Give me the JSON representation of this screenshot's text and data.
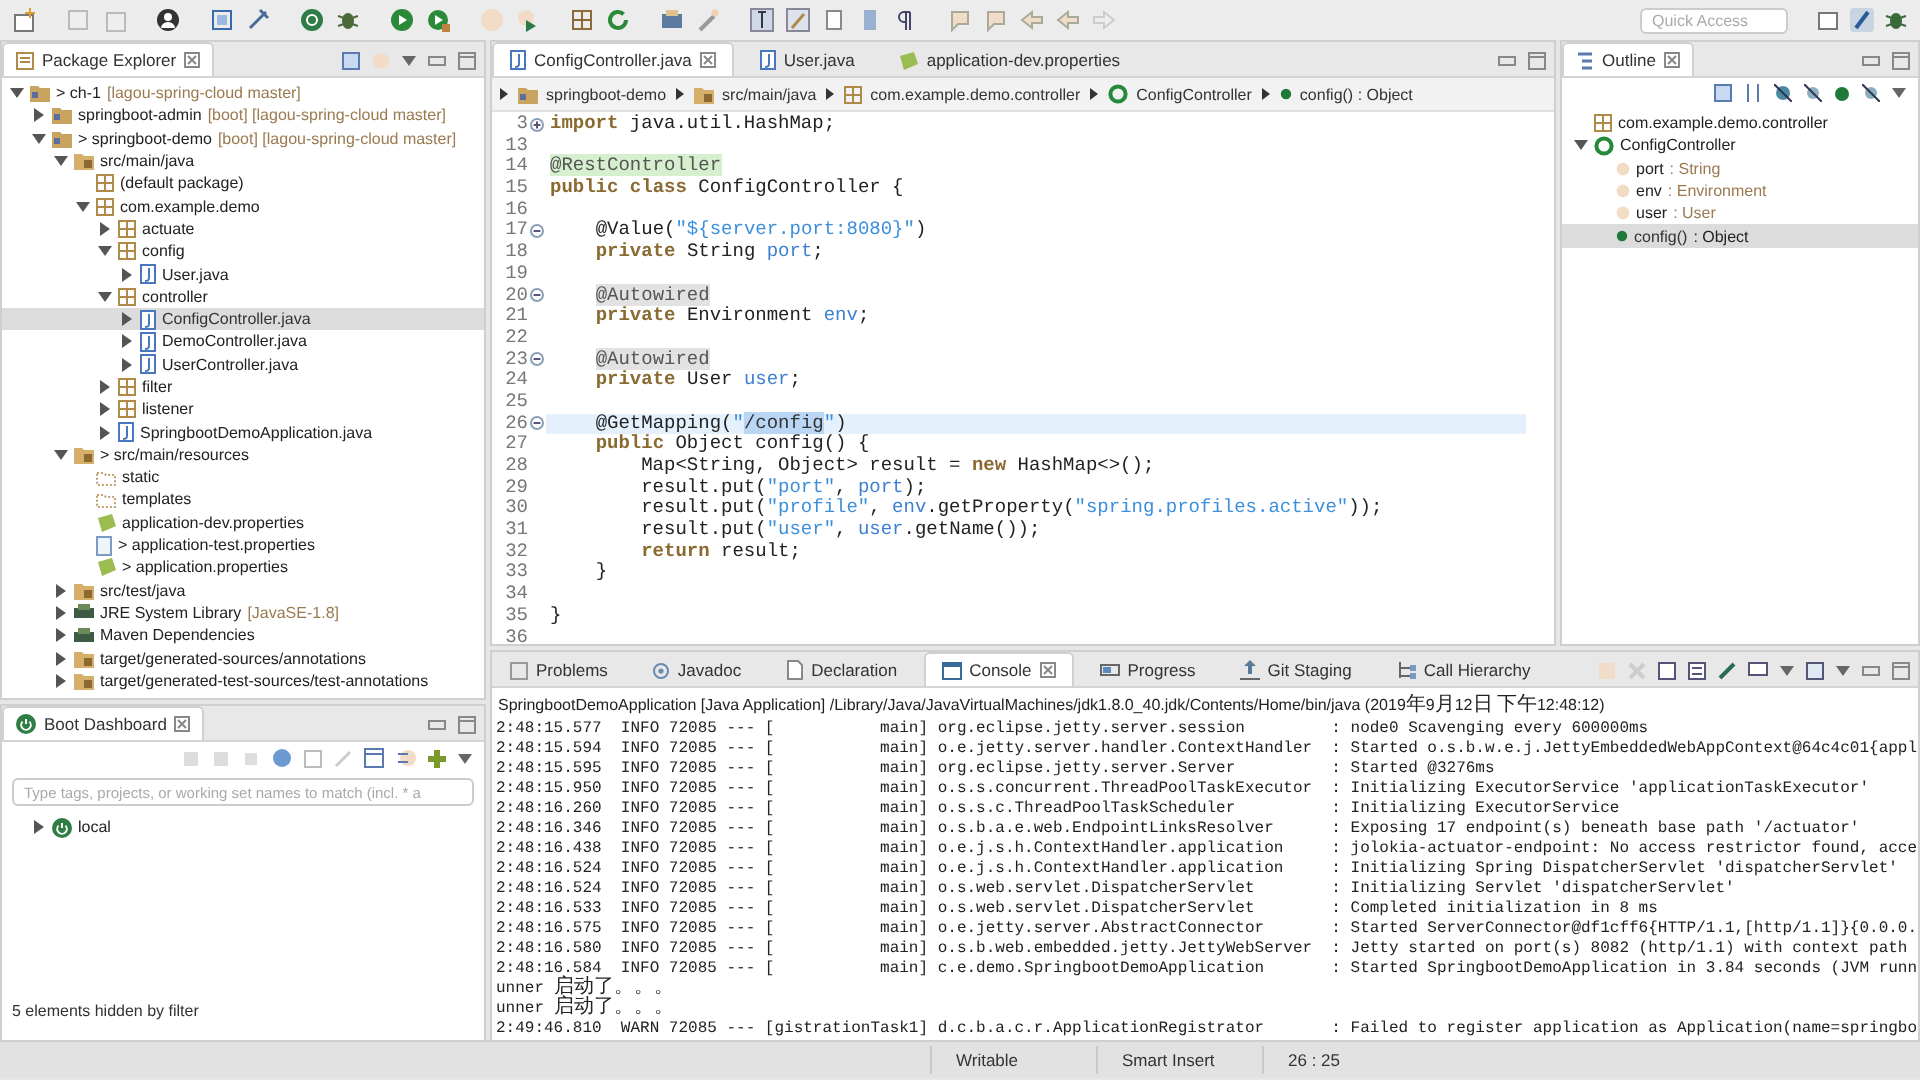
{
  "toolbar": {
    "quick_access": {
      "placeholder": "Quick Access"
    }
  },
  "package_explorer": {
    "title": "Package Explorer",
    "tree": [
      {
        "label": "> ch-1",
        "decoration": "[lagou-spring-cloud master]",
        "kind": "project",
        "expanded": true,
        "selected": false,
        "children": [
          {
            "label": "springboot-admin",
            "decoration": "[boot] [lagou-spring-cloud master]",
            "kind": "project",
            "expanded": false,
            "selected": false
          },
          {
            "label": "> springboot-demo",
            "decoration": "[boot] [lagou-spring-cloud master]",
            "kind": "project",
            "expanded": true,
            "selected": false,
            "children": [
              {
                "label": "src/main/java",
                "kind": "srcfolder",
                "expanded": true,
                "selected": false,
                "children": [
                  {
                    "label": "(default package)",
                    "kind": "package",
                    "selected": false
                  },
                  {
                    "label": "com.example.demo",
                    "kind": "package",
                    "expanded": true,
                    "selected": false,
                    "children": [
                      {
                        "label": "actuate",
                        "kind": "package",
                        "expanded": false,
                        "selected": false
                      },
                      {
                        "label": "config",
                        "kind": "package",
                        "expanded": true,
                        "selected": false,
                        "children": [
                          {
                            "label": "User.java",
                            "kind": "java",
                            "expanded": false,
                            "selected": false
                          }
                        ]
                      },
                      {
                        "label": "controller",
                        "kind": "package",
                        "expanded": true,
                        "selected": false,
                        "children": [
                          {
                            "label": "ConfigController.java",
                            "kind": "java",
                            "expanded": false,
                            "selected": true
                          },
                          {
                            "label": "DemoController.java",
                            "kind": "java",
                            "expanded": false,
                            "selected": false
                          },
                          {
                            "label": "UserController.java",
                            "kind": "java",
                            "expanded": false,
                            "selected": false
                          }
                        ]
                      },
                      {
                        "label": "filter",
                        "kind": "package",
                        "expanded": false,
                        "selected": false
                      },
                      {
                        "label": "listener",
                        "kind": "package",
                        "expanded": false,
                        "selected": false
                      },
                      {
                        "label": "SpringbootDemoApplication.java",
                        "kind": "java",
                        "expanded": false,
                        "selected": false
                      }
                    ]
                  }
                ]
              },
              {
                "label": "> src/main/resources",
                "kind": "srcfolder",
                "expanded": true,
                "selected": false,
                "children": [
                  {
                    "label": "static",
                    "kind": "folder",
                    "selected": false
                  },
                  {
                    "label": "templates",
                    "kind": "folder",
                    "selected": false
                  },
                  {
                    "label": "application-dev.properties",
                    "kind": "props",
                    "selected": false
                  },
                  {
                    "label": "> application-test.properties",
                    "kind": "file",
                    "selected": false
                  },
                  {
                    "label": "> application.properties",
                    "kind": "props",
                    "selected": false
                  }
                ]
              },
              {
                "label": "src/test/java",
                "kind": "srcfolder",
                "expanded": false,
                "selected": false
              },
              {
                "label": "JRE System Library",
                "decoration": "[JavaSE-1.8]",
                "kind": "library",
                "expanded": false,
                "selected": false
              },
              {
                "label": "Maven Dependencies",
                "kind": "library",
                "expanded": false,
                "selected": false
              },
              {
                "label": "target/generated-sources/annotations",
                "kind": "srcfolder",
                "expanded": false,
                "selected": false
              },
              {
                "label": "target/generated-test-sources/test-annotations",
                "kind": "srcfolder",
                "expanded": false,
                "selected": false
              }
            ]
          }
        ]
      }
    ]
  },
  "boot_dashboard": {
    "title": "Boot Dashboard",
    "filter": {
      "placeholder": "Type tags, projects, or working set names to match (incl. * a"
    },
    "tree": [
      {
        "label": "local",
        "kind": "boot",
        "expanded": false,
        "selected": false
      }
    ],
    "footer": "5 elements hidden by filter"
  },
  "editor": {
    "tabs": [
      {
        "label": "ConfigController.java",
        "kind": "java",
        "selected": true
      },
      {
        "label": "User.java",
        "kind": "java",
        "selected": false
      },
      {
        "label": "application-dev.properties",
        "kind": "props",
        "selected": false
      }
    ],
    "breadcrumb": [
      {
        "label": "springboot-demo",
        "kind": "project"
      },
      {
        "label": "src/main/java",
        "kind": "srcfolder"
      },
      {
        "label": "com.example.demo.controller",
        "kind": "package"
      },
      {
        "label": "ConfigController",
        "kind": "class"
      },
      {
        "label": "config() : Object",
        "kind": "method"
      }
    ],
    "lines": [
      {
        "number": "3",
        "expanded": false,
        "segments": [
          {
            "kind": "kw",
            "text": "import"
          },
          {
            "kind": "plain",
            "text": " java.util.HashMap;"
          }
        ]
      },
      {
        "number": "13"
      },
      {
        "number": "14",
        "segments": [
          {
            "kind": "ann-marked",
            "text": "@RestController"
          }
        ]
      },
      {
        "number": "15",
        "segments": [
          {
            "kind": "kw",
            "text": "public"
          },
          {
            "kind": "kw",
            "text": " class"
          },
          {
            "kind": "plain",
            "text": " ConfigController {"
          }
        ]
      },
      {
        "number": "16"
      },
      {
        "number": "17",
        "expanded": true,
        "segments": [
          {
            "kind": "plain",
            "text": "    @Value("
          },
          {
            "kind": "str",
            "text": "\"${server.port:8080}\""
          },
          {
            "kind": "plain",
            "text": ")"
          }
        ]
      },
      {
        "number": "18",
        "segments": [
          {
            "kind": "kw",
            "text": "    private"
          },
          {
            "kind": "plain",
            "text": " String "
          },
          {
            "kind": "field",
            "text": "port"
          },
          {
            "kind": "plain",
            "text": ";"
          }
        ]
      },
      {
        "number": "19"
      },
      {
        "number": "20",
        "expanded": true,
        "segments": [
          {
            "kind": "ann-match",
            "text": "    @Autowired"
          }
        ]
      },
      {
        "number": "21",
        "segments": [
          {
            "kind": "kw",
            "text": "    private"
          },
          {
            "kind": "plain",
            "text": " Environment "
          },
          {
            "kind": "field",
            "text": "env"
          },
          {
            "kind": "plain",
            "text": ";"
          }
        ]
      },
      {
        "number": "22"
      },
      {
        "number": "23",
        "expanded": true,
        "segments": [
          {
            "kind": "ann-match",
            "text": "    @Autowired"
          }
        ]
      },
      {
        "number": "24",
        "segments": [
          {
            "kind": "kw",
            "text": "    private"
          },
          {
            "kind": "plain",
            "text": " User "
          },
          {
            "kind": "field",
            "text": "user"
          },
          {
            "kind": "plain",
            "text": ";"
          }
        ]
      },
      {
        "number": "25"
      },
      {
        "number": "26",
        "expanded": true,
        "current": true,
        "segments": [
          {
            "kind": "plain",
            "text": "    @GetMapping("
          },
          {
            "kind": "str",
            "text": "\""
          },
          {
            "kind": "sel",
            "text": "/config"
          },
          {
            "kind": "str",
            "text": "\""
          },
          {
            "kind": "plain",
            "text": ")"
          }
        ]
      },
      {
        "number": "27",
        "segments": [
          {
            "kind": "kw",
            "text": "    public"
          },
          {
            "kind": "plain",
            "text": " Object config() {"
          }
        ]
      },
      {
        "number": "28",
        "segments": [
          {
            "kind": "plain",
            "text": "        Map<String, Object> result = "
          },
          {
            "kind": "kw",
            "text": "new"
          },
          {
            "kind": "plain",
            "text": " HashMap<>();"
          }
        ]
      },
      {
        "number": "29",
        "segments": [
          {
            "kind": "plain",
            "text": "        result.put("
          },
          {
            "kind": "str",
            "text": "\"port\""
          },
          {
            "kind": "plain",
            "text": ", "
          },
          {
            "kind": "field",
            "text": "port"
          },
          {
            "kind": "plain",
            "text": ");"
          }
        ]
      },
      {
        "number": "30",
        "segments": [
          {
            "kind": "plain",
            "text": "        result.put("
          },
          {
            "kind": "str",
            "text": "\"profile\""
          },
          {
            "kind": "plain",
            "text": ", "
          },
          {
            "kind": "field",
            "text": "env"
          },
          {
            "kind": "plain",
            "text": ".getProperty("
          },
          {
            "kind": "str",
            "text": "\"spring.profiles.active\""
          },
          {
            "kind": "plain",
            "text": "));"
          }
        ]
      },
      {
        "number": "31",
        "segments": [
          {
            "kind": "plain",
            "text": "        result.put("
          },
          {
            "kind": "str",
            "text": "\"user\""
          },
          {
            "kind": "plain",
            "text": ", "
          },
          {
            "kind": "field",
            "text": "user"
          },
          {
            "kind": "plain",
            "text": ".getName());"
          }
        ]
      },
      {
        "number": "32",
        "segments": [
          {
            "kind": "kw",
            "text": "        return"
          },
          {
            "kind": "plain",
            "text": " result;"
          }
        ]
      },
      {
        "number": "33",
        "segments": [
          {
            "kind": "plain",
            "text": "    }"
          }
        ]
      },
      {
        "number": "34"
      },
      {
        "number": "35",
        "segments": [
          {
            "kind": "plain",
            "text": "}"
          }
        ]
      },
      {
        "number": "36"
      }
    ]
  },
  "outline": {
    "title": "Outline",
    "tree": [
      {
        "name": "com.example.demo.controller",
        "kind": "package",
        "selected": false
      },
      {
        "name": "ConfigController",
        "kind": "class",
        "expanded": true,
        "selected": false,
        "children": [
          {
            "name": "port",
            "type": ": String",
            "kind": "field",
            "selected": false
          },
          {
            "name": "env",
            "type": ": Environment",
            "kind": "field",
            "selected": false
          },
          {
            "name": "user",
            "type": ": User",
            "kind": "field",
            "selected": false
          },
          {
            "name": "config()",
            "type": ": Object",
            "kind": "method",
            "selected": true
          }
        ]
      }
    ]
  },
  "console": {
    "tabs": [
      {
        "label": "Problems",
        "kind": "problems",
        "selected": false
      },
      {
        "label": "Javadoc",
        "kind": "at",
        "selected": false
      },
      {
        "label": "Declaration",
        "kind": "doc",
        "selected": false
      },
      {
        "label": "Console",
        "kind": "console",
        "selected": true
      },
      {
        "label": "Progress",
        "kind": "progress",
        "selected": false
      },
      {
        "label": "Git Staging",
        "kind": "git",
        "selected": false
      },
      {
        "label": "Call Hierarchy",
        "kind": "hierarchy",
        "selected": false
      }
    ],
    "header": "SpringbootDemoApplication [Java Application] /Library/Java/JavaVirtualMachines/jdk1.8.0_40.jdk/Contents/Home/bin/java (2019年9月12日 下午12:48:12)",
    "lines": [
      "2:48:15.577  INFO 72085 --- [           main] org.eclipse.jetty.server.session         : node0 Scavenging every 600000ms",
      "2:48:15.594  INFO 72085 --- [           main] o.e.jetty.server.handler.ContextHandler  : Started o.s.b.w.e.j.JettyEmbeddedWebAppContext@64c4c01{appl",
      "2:48:15.595  INFO 72085 --- [           main] org.eclipse.jetty.server.Server          : Started @3276ms",
      "2:48:15.950  INFO 72085 --- [           main] o.s.s.concurrent.ThreadPoolTaskExecutor  : Initializing ExecutorService 'applicationTaskExecutor'",
      "2:48:16.260  INFO 72085 --- [           main] o.s.s.c.ThreadPoolTaskScheduler          : Initializing ExecutorService",
      "2:48:16.346  INFO 72085 --- [           main] o.s.b.a.e.web.EndpointLinksResolver      : Exposing 17 endpoint(s) beneath base path '/actuator'",
      "2:48:16.438  INFO 72085 --- [           main] o.e.j.s.h.ContextHandler.application     : jolokia-actuator-endpoint: No access restrictor found, acce",
      "2:48:16.524  INFO 72085 --- [           main] o.e.j.s.h.ContextHandler.application     : Initializing Spring DispatcherServlet 'dispatcherServlet'",
      "2:48:16.524  INFO 72085 --- [           main] o.s.web.servlet.DispatcherServlet        : Initializing Servlet 'dispatcherServlet'",
      "2:48:16.533  INFO 72085 --- [           main] o.s.web.servlet.DispatcherServlet        : Completed initialization in 8 ms",
      "2:48:16.575  INFO 72085 --- [           main] o.e.jetty.server.AbstractConnector       : Started ServerConnector@df1cff6{HTTP/1.1,[http/1.1]}{0.0.0.",
      "2:48:16.580  INFO 72085 --- [           main] o.s.b.web.embedded.jetty.JettyWebServer  : Jetty started on port(s) 8082 (http/1.1) with context path",
      "2:48:16.584  INFO 72085 --- [           main] c.e.demo.SpringbootDemoApplication       : Started SpringbootDemoApplication in 3.84 seconds (JVM runn",
      "unner 启动了。。。",
      "unner 启动了。。。",
      "2:49:46.810  WARN 72085 --- [gistrationTask1] d.c.b.a.c.r.ApplicationRegistrator       : Failed to register application as Application(name=springbo"
    ]
  },
  "status_bar": {
    "fields": [
      "Writable",
      "Smart Insert",
      "26 : 25"
    ]
  }
}
